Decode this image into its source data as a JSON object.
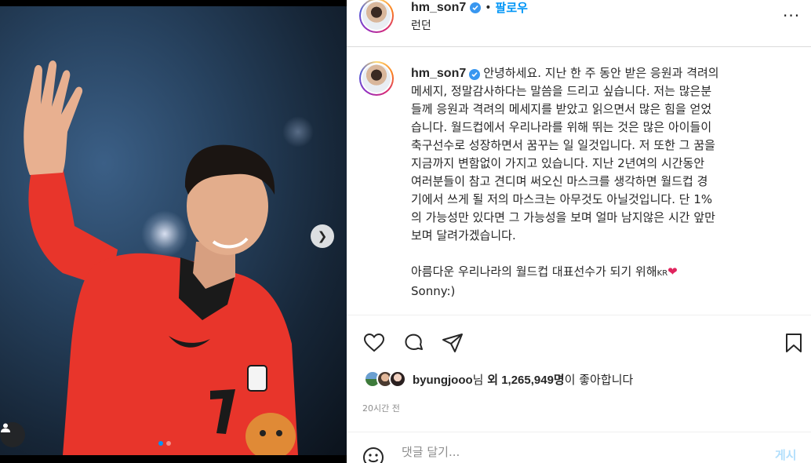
{
  "post": {
    "username": "hm_son7",
    "follow_label": "팔로우",
    "separator": "•",
    "location": "런던",
    "more_label": "···",
    "caption_lines": [
      "안녕하세요. 지난 한 주 동안 받은 응원과 격려의",
      "메세지, 정말감사하다는 말씀을 드리고 싶습니다. 저는 많은분",
      "들께 응원과 격려의 메세지를 받았고 읽으면서 많은 힘을 얻었",
      "습니다. 월드컵에서 우리나라를 위해 뛰는 것은 많은 아이들이",
      "축구선수로 성장하면서 꿈꾸는 일 일것입니다. 저 또한 그 꿈을",
      "지금까지 변함없이 가지고 있습니다. 지난 2년여의 시간동안",
      "여러분들이 참고 견디며 써오신 마스크를 생각하면 월드컵 경",
      "기에서 쓰게 될 저의 마스크는 아무것도 아닐것입니다. 단 1%",
      "의 가능성만 있다면 그 가능성을 보며 얼마 남지않은 시간 앞만",
      "보며 달려가겠습니다."
    ],
    "caption_closing": "아름다운 우리나라의 월드컵 대표선수가 되기 위해",
    "caption_flag": "KR",
    "caption_heart": "❤",
    "caption_signoff": "Sonny:)",
    "liked_by_user": "byungjooo",
    "likes_suffix_1": "님 ",
    "likes_bold": "외 1,265,949명",
    "likes_suffix_2": "이 좋아합니다",
    "time_ago": "20시간 전",
    "comment_placeholder": "댓글 달기...",
    "post_button": "게시"
  },
  "media": {
    "next_icon": "chevron-right-icon",
    "tag_icon": "user-tag-icon",
    "carousel_total": 2,
    "carousel_active": 1
  },
  "colors": {
    "follow_blue": "#0095f6",
    "verified_blue": "#3897f0",
    "jersey_red": "#e8352b",
    "post_disabled": "#b2dffc"
  }
}
